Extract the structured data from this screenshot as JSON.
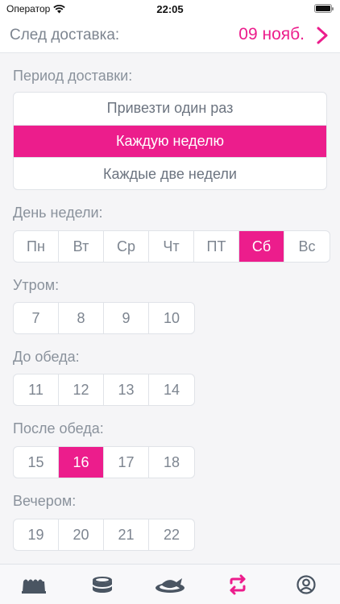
{
  "status": {
    "carrier": "Оператор",
    "time": "22:05"
  },
  "header": {
    "label": "След доставка:",
    "date": "09 нояб."
  },
  "colors": {
    "accent": "#ec1d8c",
    "text": "#7d8590",
    "border": "#e0e3e8"
  },
  "period": {
    "label": "Период доставки:",
    "options": [
      "Привезти один раз",
      "Каждую неделю",
      "Каждые две недели"
    ],
    "selected": "Каждую неделю"
  },
  "weekday": {
    "label": "День недели:",
    "days": [
      "Пн",
      "Вт",
      "Ср",
      "Чт",
      "ПТ",
      "Сб",
      "Вс"
    ],
    "selected": "Сб"
  },
  "slots": {
    "morning": {
      "label": "Утром:",
      "hours": [
        "7",
        "8",
        "9",
        "10"
      ]
    },
    "before_lunch": {
      "label": "До обеда:",
      "hours": [
        "11",
        "12",
        "13",
        "14"
      ]
    },
    "after_lunch": {
      "label": "После обеда:",
      "hours": [
        "15",
        "16",
        "17",
        "18"
      ]
    },
    "evening": {
      "label": "Вечером:",
      "hours": [
        "19",
        "20",
        "21",
        "22"
      ]
    },
    "selected": "16"
  },
  "tabs": [
    {
      "icon": "bakery-tray-icon"
    },
    {
      "icon": "food-tin-icon"
    },
    {
      "icon": "fish-plate-icon"
    },
    {
      "icon": "repeat-icon",
      "active": true
    },
    {
      "icon": "profile-icon"
    }
  ]
}
